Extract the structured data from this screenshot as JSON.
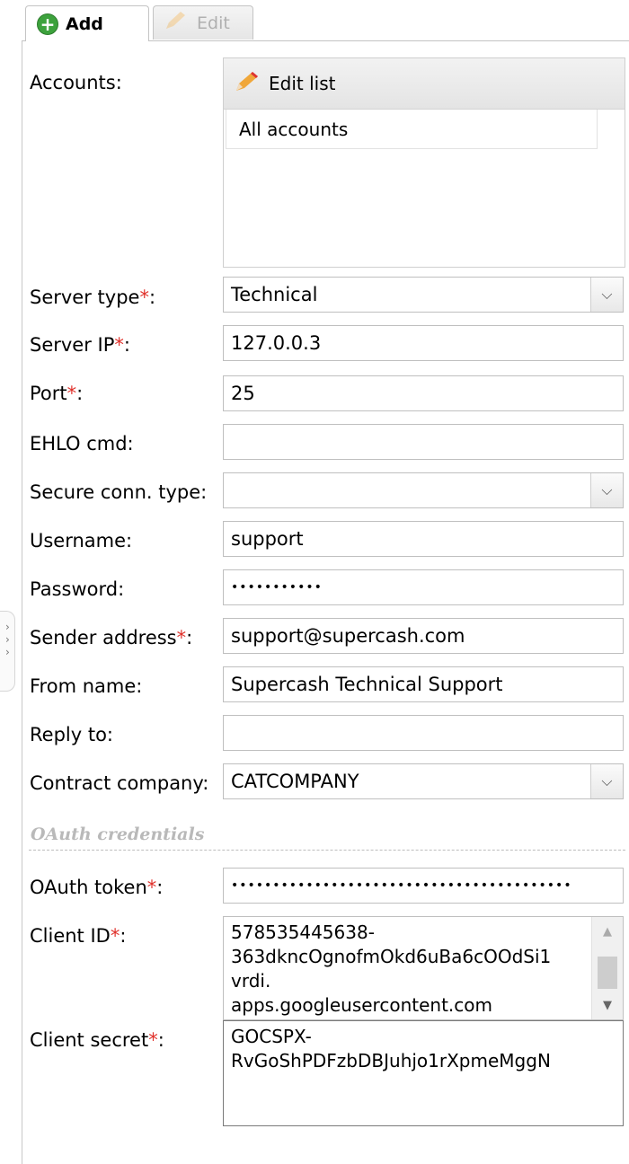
{
  "tabs": {
    "add_label": "Add",
    "edit_label": "Edit"
  },
  "accounts": {
    "label": "Accounts:",
    "edit_list_label": "Edit list",
    "items": [
      "All accounts"
    ]
  },
  "form": {
    "server_type": {
      "label": "Server type",
      "value": "Technical"
    },
    "server_ip": {
      "label": "Server IP",
      "value": "127.0.0.3"
    },
    "port": {
      "label": "Port",
      "value": "25"
    },
    "ehlo_cmd": {
      "label": "EHLO cmd:",
      "value": ""
    },
    "secure_conn_type": {
      "label": "Secure conn. type:",
      "value": ""
    },
    "username": {
      "label": "Username:",
      "value": "support"
    },
    "password": {
      "label": "Password:",
      "value": "•••••••••••"
    },
    "sender_address": {
      "label": "Sender address",
      "value": "support@supercash.com"
    },
    "from_name": {
      "label": "From name:",
      "value": "Supercash Technical Support"
    },
    "reply_to": {
      "label": "Reply to:",
      "value": ""
    },
    "contract_company": {
      "label": "Contract company:",
      "value": "CATCOMPANY"
    }
  },
  "oauth": {
    "section_title": "OAuth credentials",
    "token": {
      "label": "OAuth token",
      "value": "•••••••••••••••••••••••••••••••••••••••••"
    },
    "client_id": {
      "label": "Client ID",
      "line1": "578535445638-",
      "line2": "363dkncOgnofmOkd6uBa6cOOdSi1",
      "line3": "vrdi.",
      "line4": "apps.googleusercontent.com"
    },
    "client_secret": {
      "label": "Client secret",
      "line1": "GOCSPX-",
      "line2": "RvGoShPDFzbDBJuhjo1rXpmeMggN"
    }
  },
  "required_marker": "*",
  "colon": ":",
  "colors": {
    "required": "#e0302a",
    "add_icon": "#3da23d",
    "section_title": "#b9b9b9"
  }
}
